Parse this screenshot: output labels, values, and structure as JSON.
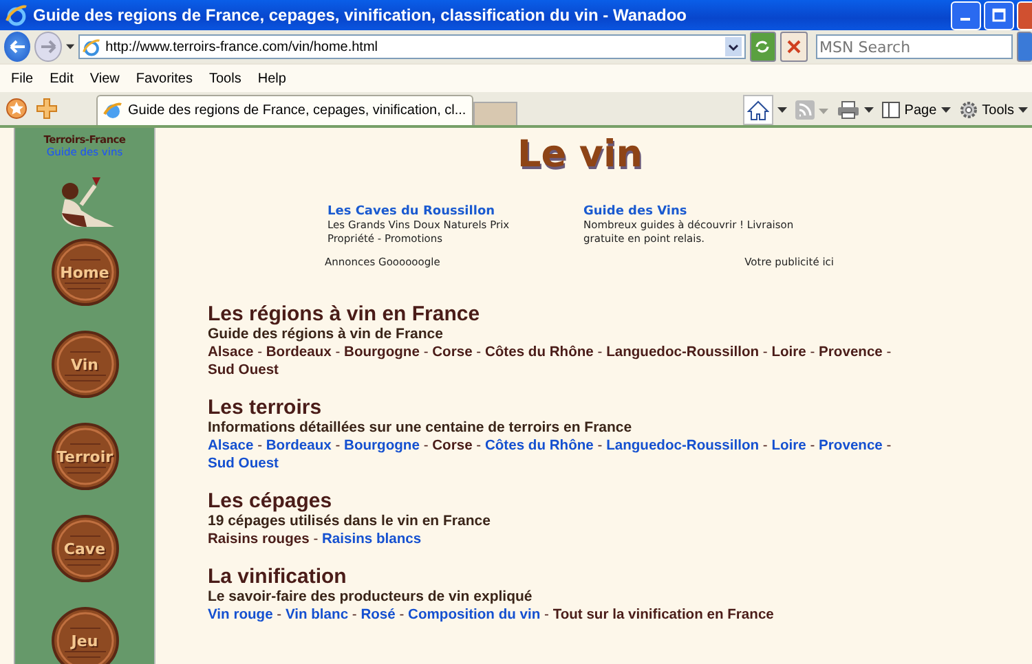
{
  "window": {
    "title": "Guide des regions de France, cepages, vinification, classification du vin - Wanadoo"
  },
  "address_bar": {
    "url": "http://www.terroirs-france.com/vin/home.html"
  },
  "search": {
    "placeholder": "MSN Search"
  },
  "menu": [
    "File",
    "Edit",
    "View",
    "Favorites",
    "Tools",
    "Help"
  ],
  "tabs": [
    {
      "label": "Guide des regions de France, cepages, vinification, cl...",
      "selected": true
    }
  ],
  "command_bar": [
    {
      "kind": "home"
    },
    {
      "kind": "feed"
    },
    {
      "kind": "print"
    },
    {
      "kind": "page",
      "label": "Page"
    },
    {
      "kind": "tools",
      "label": "Tools"
    }
  ],
  "sidebar": {
    "site_name": "Terroirs-France",
    "tagline": "Guide des vins",
    "nav": [
      "Home",
      "Vin",
      "Terroir",
      "Cave",
      "Jeu"
    ]
  },
  "page": {
    "title": "Le vin",
    "ads": [
      {
        "title": "Les Caves du Roussillon",
        "text": "Les Grands Vins Doux Naturels Prix Propriété - Promotions"
      },
      {
        "title": "Guide des Vins",
        "text": "Nombreux guides à découvrir ! Livraison gratuite en point relais."
      }
    ],
    "ads_label": "Annonces Goooooogle",
    "ads_promo": "Votre publicité ici",
    "separator": "-",
    "sections": [
      {
        "heading": "Les régions à vin en France",
        "subtitle": "Guide des régions à vin de France",
        "links": [
          {
            "label": "Alsace",
            "link": false
          },
          {
            "label": "Bordeaux",
            "link": false
          },
          {
            "label": "Bourgogne",
            "link": false
          },
          {
            "label": "Corse",
            "link": false
          },
          {
            "label": "Côtes du Rhône",
            "link": false
          },
          {
            "label": "Languedoc-Roussillon",
            "link": false
          },
          {
            "label": "Loire",
            "link": false
          },
          {
            "label": "Provence",
            "link": false
          },
          {
            "label": "Sud Ouest",
            "link": false
          }
        ]
      },
      {
        "heading": "Les terroirs",
        "subtitle": "Informations détaillées sur une centaine de terroirs en France",
        "links": [
          {
            "label": "Alsace",
            "link": true
          },
          {
            "label": "Bordeaux",
            "link": true
          },
          {
            "label": "Bourgogne",
            "link": true
          },
          {
            "label": "Corse",
            "link": false
          },
          {
            "label": "Côtes du Rhône",
            "link": true
          },
          {
            "label": "Languedoc-Roussillon",
            "link": true
          },
          {
            "label": "Loire",
            "link": true
          },
          {
            "label": "Provence",
            "link": true
          },
          {
            "label": "Sud Ouest",
            "link": true
          }
        ]
      },
      {
        "heading": "Les cépages",
        "subtitle": "19 cépages utilisés dans le vin en France",
        "links": [
          {
            "label": "Raisins rouges",
            "link": false
          },
          {
            "label": "Raisins blancs",
            "link": true
          }
        ]
      },
      {
        "heading": "La vinification",
        "subtitle": "Le savoir-faire des producteurs de vin expliqué",
        "links": [
          {
            "label": "Vin rouge",
            "link": true
          },
          {
            "label": "Vin blanc",
            "link": true
          },
          {
            "label": "Rosé",
            "link": true
          },
          {
            "label": "Composition du vin",
            "link": true
          },
          {
            "label": "Tout sur la vinification en France",
            "link": false
          }
        ]
      }
    ]
  }
}
